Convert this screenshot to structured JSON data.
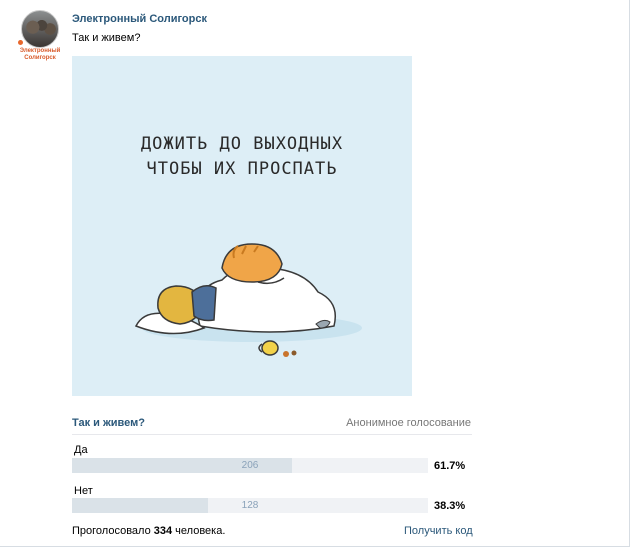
{
  "post": {
    "author": "Электронный Солигорск",
    "avatar_caption": "Электронный Солигорск",
    "text": "Так и живем?",
    "image_text_lines": [
      "ДОЖИТЬ ДО ВЫХОДНЫХ",
      "ЧТОБЫ ИХ ПРОСПАТЬ"
    ]
  },
  "poll": {
    "question": "Так и живем?",
    "type": "Анонимное голосование",
    "options": [
      {
        "label": "Да",
        "votes": "206",
        "percent": "61.7%",
        "fraction": 0.617
      },
      {
        "label": "Нет",
        "votes": "128",
        "percent": "38.3%",
        "fraction": 0.383
      }
    ],
    "voted_prefix": "Проголосовало",
    "voted_count": "334",
    "voted_suffix": "человека.",
    "get_code": "Получить код"
  },
  "colors": {
    "link": "#2b587a",
    "bar_fill": "#dae2e8",
    "bar_track": "#f0f2f5",
    "image_bg": "#ddeef6",
    "accent_orange": "#e8672c"
  }
}
